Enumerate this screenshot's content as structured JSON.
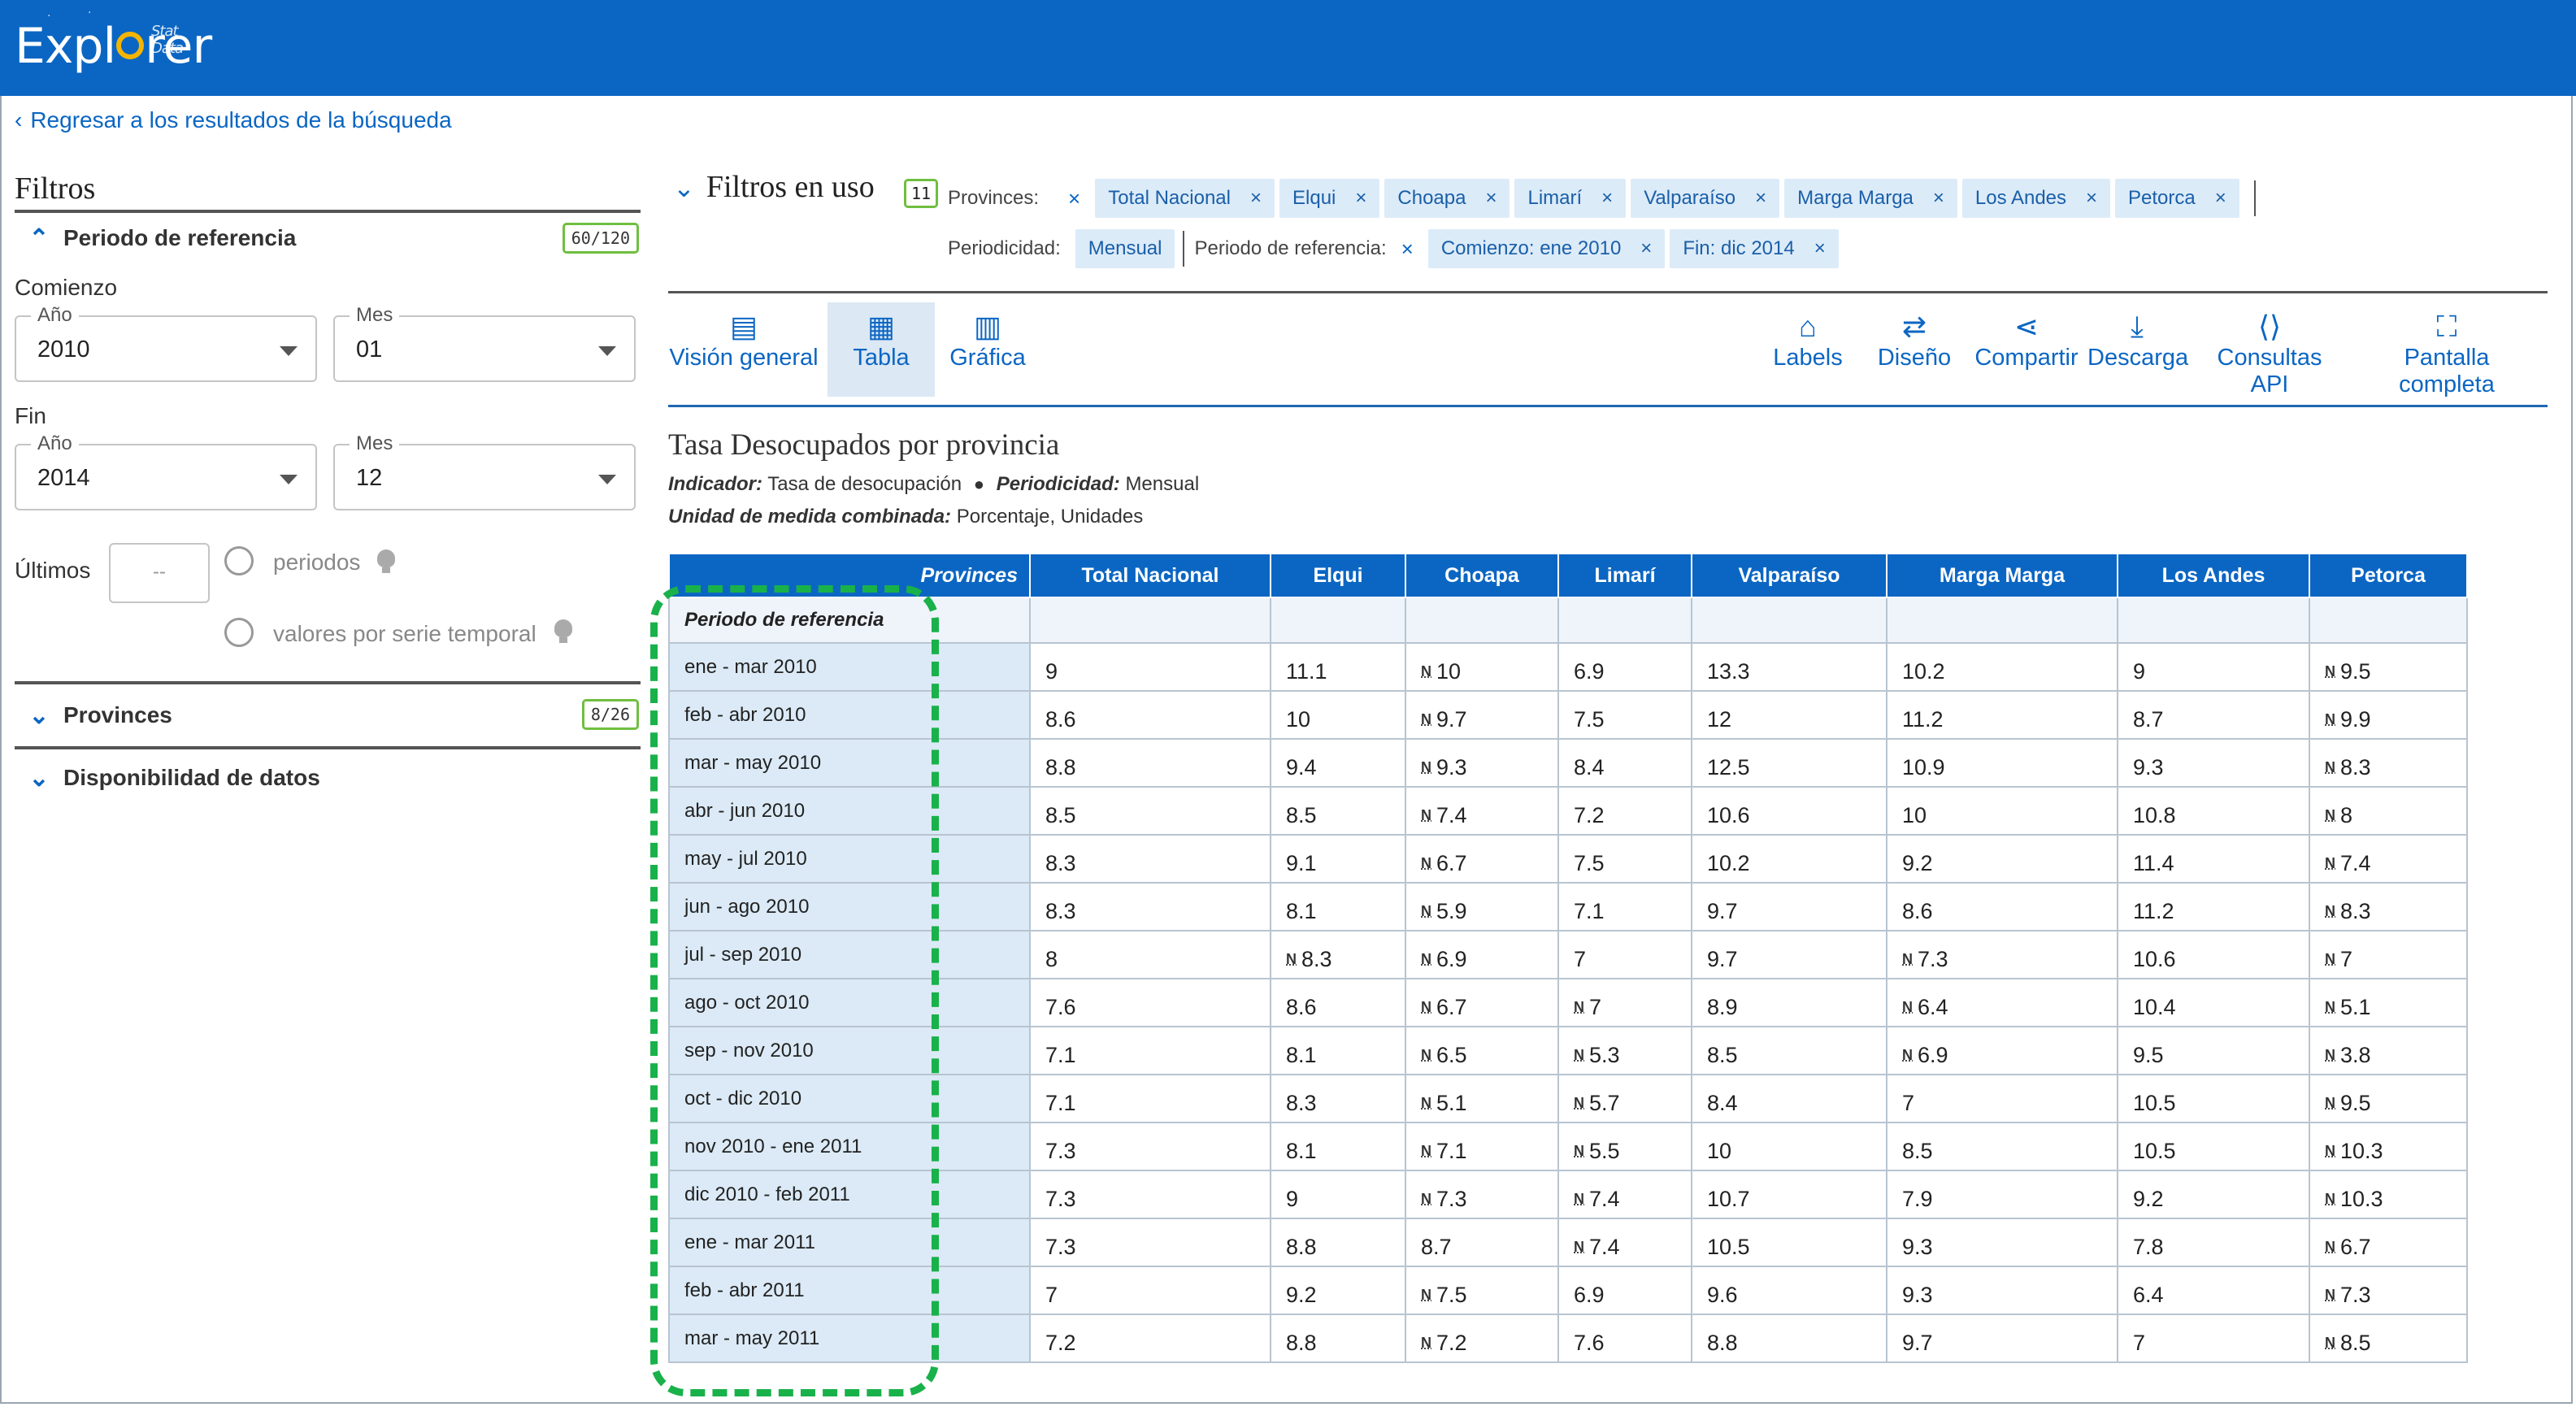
{
  "app": {
    "logo_text": "Explorer",
    "logo_sub": "Stat Data"
  },
  "nav": {
    "back_label": "Regresar a los resultados de la búsqueda"
  },
  "filters": {
    "title": "Filtros",
    "periodo": {
      "label": "Periodo de referencia",
      "badge": "60/120"
    },
    "comienzo": {
      "label": "Comienzo",
      "anio_label": "Año",
      "anio_value": "2010",
      "mes_label": "Mes",
      "mes_value": "01"
    },
    "fin": {
      "label": "Fin",
      "anio_label": "Año",
      "anio_value": "2014",
      "mes_label": "Mes",
      "mes_value": "12"
    },
    "ultimos": {
      "label": "Últimos",
      "placeholder": "--",
      "opt1": "periodos",
      "opt2": "valores por serie temporal"
    },
    "provinces": {
      "label": "Provinces",
      "badge": "8/26"
    },
    "disponibilidad": {
      "label": "Disponibilidad de datos"
    }
  },
  "in_use": {
    "title": "Filtros en uso",
    "badge": "11",
    "provinces_label": "Provinces:",
    "provinces": [
      "Total Nacional",
      "Elqui",
      "Choapa",
      "Limarí",
      "Valparaíso",
      "Marga Marga",
      "Los Andes",
      "Petorca"
    ],
    "periodicidad_label": "Periodicidad:",
    "periodicidad_value": "Mensual",
    "periodo_label": "Periodo de referencia:",
    "comienzo_chip": "Comienzo: ene 2010",
    "fin_chip": "Fin: dic 2014"
  },
  "toolbar": {
    "vision": "Visión general",
    "tabla": "Tabla",
    "grafica": "Gráfica",
    "labels": "Labels",
    "diseno": "Diseño",
    "compartir": "Compartir",
    "descarga": "Descarga",
    "api": "Consultas API",
    "pantalla": "Pantalla completa"
  },
  "table_info": {
    "title": "Tasa Desocupados por provincia",
    "indicador_label": "Indicador:",
    "indicador_value": "Tasa de desocupación",
    "periodicidad_label": "Periodicidad:",
    "periodicidad_value": "Mensual",
    "unidad_label": "Unidad de medida combinada:",
    "unidad_value": "Porcentaje, Unidades"
  },
  "table": {
    "corner_label": "Provinces",
    "row_header_label": "Periodo de referencia",
    "columns": [
      "Total Nacional",
      "Elqui",
      "Choapa",
      "Limarí",
      "Valparaíso",
      "Marga Marga",
      "Los Andes",
      "Petorca"
    ],
    "flag_symbol": "N",
    "rows": [
      {
        "period": "ene - mar 2010",
        "cells": [
          [
            "9",
            false
          ],
          [
            "11.1",
            false
          ],
          [
            "10",
            true
          ],
          [
            "6.9",
            false
          ],
          [
            "13.3",
            false
          ],
          [
            "10.2",
            false
          ],
          [
            "9",
            false
          ],
          [
            "9.5",
            true
          ]
        ]
      },
      {
        "period": "feb - abr 2010",
        "cells": [
          [
            "8.6",
            false
          ],
          [
            "10",
            false
          ],
          [
            "9.7",
            true
          ],
          [
            "7.5",
            false
          ],
          [
            "12",
            false
          ],
          [
            "11.2",
            false
          ],
          [
            "8.7",
            false
          ],
          [
            "9.9",
            true
          ]
        ]
      },
      {
        "period": "mar - may 2010",
        "cells": [
          [
            "8.8",
            false
          ],
          [
            "9.4",
            false
          ],
          [
            "9.3",
            true
          ],
          [
            "8.4",
            false
          ],
          [
            "12.5",
            false
          ],
          [
            "10.9",
            false
          ],
          [
            "9.3",
            false
          ],
          [
            "8.3",
            true
          ]
        ]
      },
      {
        "period": "abr - jun 2010",
        "cells": [
          [
            "8.5",
            false
          ],
          [
            "8.5",
            false
          ],
          [
            "7.4",
            true
          ],
          [
            "7.2",
            false
          ],
          [
            "10.6",
            false
          ],
          [
            "10",
            false
          ],
          [
            "10.8",
            false
          ],
          [
            "8",
            true
          ]
        ]
      },
      {
        "period": "may - jul 2010",
        "cells": [
          [
            "8.3",
            false
          ],
          [
            "9.1",
            false
          ],
          [
            "6.7",
            true
          ],
          [
            "7.5",
            false
          ],
          [
            "10.2",
            false
          ],
          [
            "9.2",
            false
          ],
          [
            "11.4",
            false
          ],
          [
            "7.4",
            true
          ]
        ]
      },
      {
        "period": "jun - ago 2010",
        "cells": [
          [
            "8.3",
            false
          ],
          [
            "8.1",
            false
          ],
          [
            "5.9",
            true
          ],
          [
            "7.1",
            false
          ],
          [
            "9.7",
            false
          ],
          [
            "8.6",
            false
          ],
          [
            "11.2",
            false
          ],
          [
            "8.3",
            true
          ]
        ]
      },
      {
        "period": "jul - sep 2010",
        "cells": [
          [
            "8",
            false
          ],
          [
            "8.3",
            true
          ],
          [
            "6.9",
            true
          ],
          [
            "7",
            false
          ],
          [
            "9.7",
            false
          ],
          [
            "7.3",
            true
          ],
          [
            "10.6",
            false
          ],
          [
            "7",
            true
          ]
        ]
      },
      {
        "period": "ago - oct 2010",
        "cells": [
          [
            "7.6",
            false
          ],
          [
            "8.6",
            false
          ],
          [
            "6.7",
            true
          ],
          [
            "7",
            true
          ],
          [
            "8.9",
            false
          ],
          [
            "6.4",
            true
          ],
          [
            "10.4",
            false
          ],
          [
            "5.1",
            true
          ]
        ]
      },
      {
        "period": "sep - nov 2010",
        "cells": [
          [
            "7.1",
            false
          ],
          [
            "8.1",
            false
          ],
          [
            "6.5",
            true
          ],
          [
            "5.3",
            true
          ],
          [
            "8.5",
            false
          ],
          [
            "6.9",
            true
          ],
          [
            "9.5",
            false
          ],
          [
            "3.8",
            true
          ]
        ]
      },
      {
        "period": "oct - dic 2010",
        "cells": [
          [
            "7.1",
            false
          ],
          [
            "8.3",
            false
          ],
          [
            "5.1",
            true
          ],
          [
            "5.7",
            true
          ],
          [
            "8.4",
            false
          ],
          [
            "7",
            false
          ],
          [
            "10.5",
            false
          ],
          [
            "9.5",
            true
          ]
        ]
      },
      {
        "period": "nov 2010 - ene 2011",
        "cells": [
          [
            "7.3",
            false
          ],
          [
            "8.1",
            false
          ],
          [
            "7.1",
            true
          ],
          [
            "5.5",
            true
          ],
          [
            "10",
            false
          ],
          [
            "8.5",
            false
          ],
          [
            "10.5",
            false
          ],
          [
            "10.3",
            true
          ]
        ]
      },
      {
        "period": "dic 2010 - feb 2011",
        "cells": [
          [
            "7.3",
            false
          ],
          [
            "9",
            false
          ],
          [
            "7.3",
            true
          ],
          [
            "7.4",
            true
          ],
          [
            "10.7",
            false
          ],
          [
            "7.9",
            false
          ],
          [
            "9.2",
            false
          ],
          [
            "10.3",
            true
          ]
        ]
      },
      {
        "period": "ene - mar 2011",
        "cells": [
          [
            "7.3",
            false
          ],
          [
            "8.8",
            false
          ],
          [
            "8.7",
            false
          ],
          [
            "7.4",
            true
          ],
          [
            "10.5",
            false
          ],
          [
            "9.3",
            false
          ],
          [
            "7.8",
            false
          ],
          [
            "6.7",
            true
          ]
        ]
      },
      {
        "period": "feb - abr 2011",
        "cells": [
          [
            "7",
            false
          ],
          [
            "9.2",
            false
          ],
          [
            "7.5",
            true
          ],
          [
            "6.9",
            false
          ],
          [
            "9.6",
            false
          ],
          [
            "9.3",
            false
          ],
          [
            "6.4",
            false
          ],
          [
            "7.3",
            true
          ]
        ]
      },
      {
        "period": "mar - may 2011",
        "cells": [
          [
            "7.2",
            false
          ],
          [
            "8.8",
            false
          ],
          [
            "7.2",
            true
          ],
          [
            "7.6",
            false
          ],
          [
            "8.8",
            false
          ],
          [
            "9.7",
            false
          ],
          [
            "7",
            false
          ],
          [
            "8.5",
            true
          ]
        ]
      }
    ]
  },
  "colors": {
    "brand": "#0b66c3",
    "chip_bg": "#dcebf8",
    "badge_border": "#6fbf3f",
    "highlight": "#19b14a"
  }
}
